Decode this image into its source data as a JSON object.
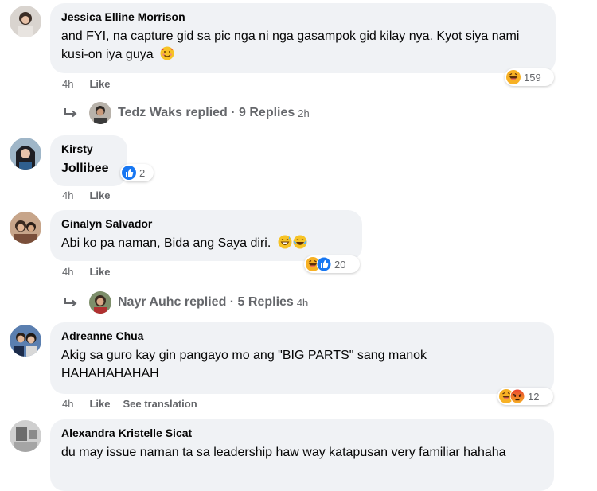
{
  "comments": [
    {
      "author": "Jessica Elline Morrison",
      "text": "and FYI, na capture gid sa pic nga ni nga gasampok gid kilay nya. Kyot siya nami kusi-on iya guya",
      "inline_emoji": "smiling-face-with-hearts-icon",
      "time": "4h",
      "like": "Like",
      "reaction_count": "159",
      "replies": {
        "text": "Tedz Waks replied · 9 Replies",
        "time": "2h"
      }
    },
    {
      "author": "Kirsty",
      "text": "Jollibee",
      "time": "4h",
      "like": "Like",
      "reaction_count": "2"
    },
    {
      "author": "Ginalyn Salvador",
      "text": "Abi ko pa naman, Bida ang Saya diri.",
      "time": "4h",
      "like": "Like",
      "reaction_count": "20",
      "replies": {
        "text": "Nayr Auhc replied · 5 Replies",
        "time": "4h"
      }
    },
    {
      "author": "Adreanne Chua",
      "text": "Akig sa guro kay gin pangayo mo ang \"BIG PARTS\" sang manok HAHAHAHAHAH",
      "time": "4h",
      "like": "Like",
      "translate": "See translation",
      "reaction_count": "12"
    },
    {
      "author": "Alexandra Kristelle Sicat",
      "text": "du may issue naman ta sa leadership haw way katapusan very familiar hahaha"
    }
  ],
  "colors": {
    "bubble": "#f0f2f5",
    "meta": "#65676b",
    "like_blue": "#1877f2",
    "haha": "#f7b125",
    "angry": "#e9710f"
  }
}
